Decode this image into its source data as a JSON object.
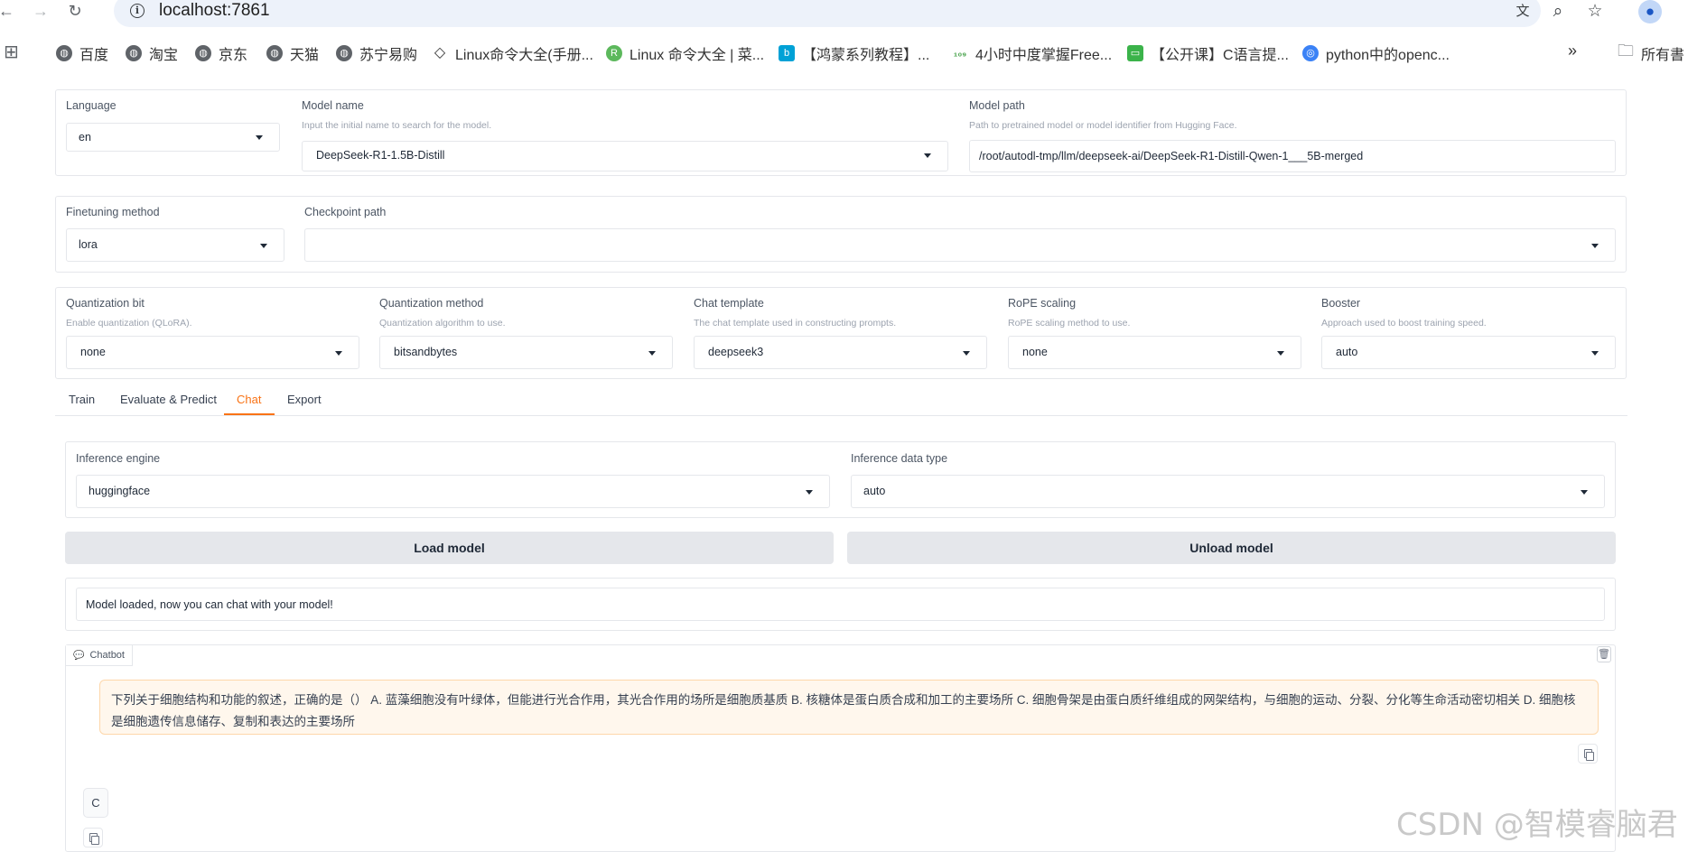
{
  "browser": {
    "url": "localhost:7861",
    "bookmarks": [
      "百度",
      "淘宝",
      "京东",
      "天猫",
      "苏宁易购",
      "Linux命令大全(手册...",
      "Linux 命令大全 | 菜...",
      "【鸿蒙系列教程】...",
      "4小时中度掌握Free...",
      "【公开课】C语言提...",
      "python中的openc..."
    ],
    "bookmarks_more": "»",
    "all_bookmarks": "所有書"
  },
  "top": {
    "language": {
      "label": "Language",
      "value": "en"
    },
    "model_name": {
      "label": "Model name",
      "info": "Input the initial name to search for the model.",
      "value": "DeepSeek-R1-1.5B-Distill"
    },
    "model_path": {
      "label": "Model path",
      "info": "Path to pretrained model or model identifier from Hugging Face.",
      "value": "/root/autodl-tmp/llm/deepseek-ai/DeepSeek-R1-Distill-Qwen-1___5B-merged"
    }
  },
  "finetune": {
    "method": {
      "label": "Finetuning method",
      "value": "lora"
    },
    "checkpoint": {
      "label": "Checkpoint path",
      "value": ""
    }
  },
  "advanced": {
    "quant_bit": {
      "label": "Quantization bit",
      "info": "Enable quantization (QLoRA).",
      "value": "none"
    },
    "quant_method": {
      "label": "Quantization method",
      "info": "Quantization algorithm to use.",
      "value": "bitsandbytes"
    },
    "template": {
      "label": "Chat template",
      "info": "The chat template used in constructing prompts.",
      "value": "deepseek3"
    },
    "rope": {
      "label": "RoPE scaling",
      "info": "RoPE scaling method to use.",
      "value": "none"
    },
    "booster": {
      "label": "Booster",
      "info": "Approach used to boost training speed.",
      "value": "auto"
    }
  },
  "tabs": [
    "Train",
    "Evaluate & Predict",
    "Chat",
    "Export"
  ],
  "chat": {
    "engine": {
      "label": "Inference engine",
      "value": "huggingface"
    },
    "dtype": {
      "label": "Inference data type",
      "value": "auto"
    },
    "load_button": "Load model",
    "unload_button": "Unload model",
    "status": "Model loaded, now you can chat with your model!",
    "chatbot_label": "Chatbot",
    "user_message": "下列关于细胞结构和功能的叙述，正确的是（）  A. 蓝藻细胞没有叶绿体，但能进行光合作用，其光合作用的场所是细胞质基质 B. 核糖体是蛋白质合成和加工的主要场所 C. 细胞骨架是由蛋白质纤维组成的网架结构，与细胞的运动、分裂、分化等生命活动密切相关 D. 细胞核是细胞遗传信息储存、复制和表达的主要场所",
    "bot_message": "C"
  },
  "watermark": "CSDN @智模睿脑君",
  "colors": {
    "accent": "#f97316",
    "user_bubble_bg": "#fff7ed",
    "user_bubble_border": "#fed7aa",
    "button_bg": "#e5e7eb"
  }
}
